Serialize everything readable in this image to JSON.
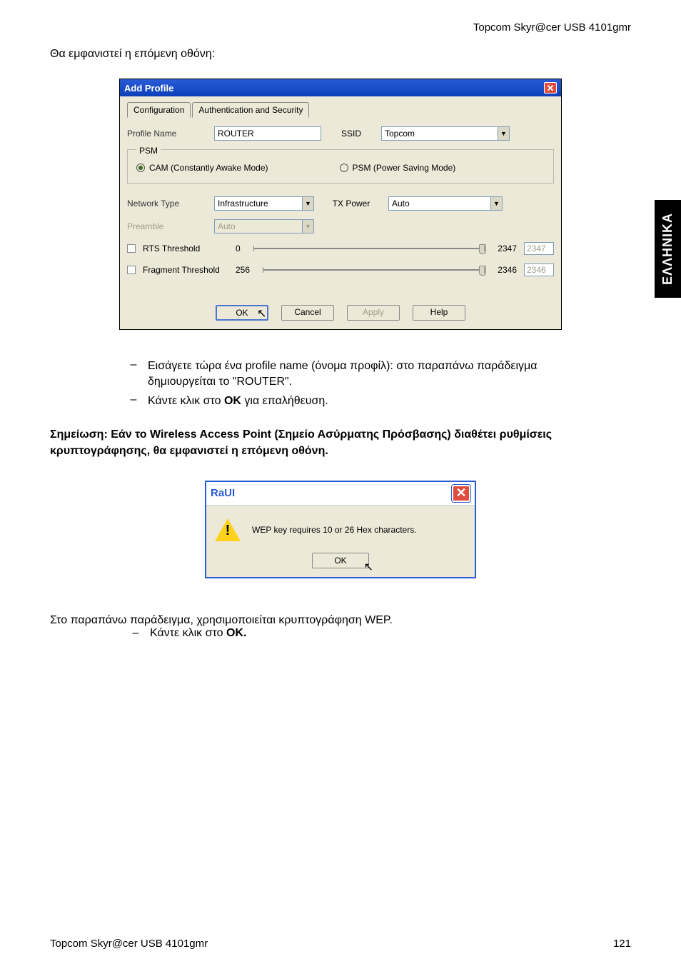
{
  "header": {
    "product": "Topcom Skyr@cer USB 4101gmr"
  },
  "intro": "Θα εμφανιστεί η επόμενη οθόνη:",
  "side_tab": "ΕΛΛΗΝΙΚΑ",
  "dialog": {
    "title": "Add Profile",
    "tabs": {
      "config": "Configuration",
      "auth": "Authentication and Security"
    },
    "profile_name_label": "Profile Name",
    "profile_name_value": "ROUTER",
    "ssid_label": "SSID",
    "ssid_value": "Topcom",
    "psm": {
      "legend": "PSM",
      "cam": "CAM (Constantly Awake Mode)",
      "psm_mode": "PSM (Power Saving Mode)"
    },
    "network_type_label": "Network Type",
    "network_type_value": "Infrastructure",
    "tx_power_label": "TX Power",
    "tx_power_value": "Auto",
    "preamble_label": "Preamble",
    "preamble_value": "Auto",
    "rts": {
      "label": "RTS Threshold",
      "min": "0",
      "max": "2347",
      "value": "2347"
    },
    "frag": {
      "label": "Fragment Threshold",
      "min": "256",
      "max": "2346",
      "value": "2346"
    },
    "buttons": {
      "ok": "OK",
      "cancel": "Cancel",
      "apply": "Apply",
      "help": "Help"
    }
  },
  "bullets": {
    "b1": "Εισάγετε τώρα ένα profile name (όνομα προφίλ): στο παραπάνω παράδειγμα δημιουργείται το \"ROUTER\".",
    "b2_pre": "Κάντε κλικ στο ",
    "b2_bold": "OK",
    "b2_post": " για επαλήθευση."
  },
  "note": "Σημείωση: Εάν το Wireless Access Point (Σημείο Ασύρματης Πρόσβασης) διαθέτει ρυθμίσεις κρυπτογράφησης, θα εμφανιστεί η επόμενη οθόνη.",
  "small_dialog": {
    "title": "RaUI",
    "message": "WEP key requires 10 or 26 Hex characters.",
    "ok": "OK"
  },
  "foot": {
    "line1": "Στο παραπάνω παράδειγμα, χρησιμοποιείται κρυπτογράφηση WEP.",
    "b_pre": "Κάντε κλικ στο ",
    "b_bold": "OK."
  },
  "footer": {
    "left": "Topcom Skyr@cer USB 4101gmr",
    "right": "121"
  }
}
